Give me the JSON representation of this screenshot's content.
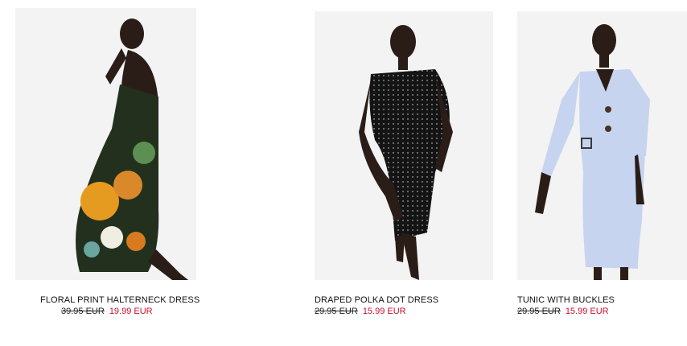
{
  "products": [
    {
      "name": "FLORAL PRINT HALTERNECK DRESS",
      "old_price": "39.95 EUR",
      "sale_price": "19.99 EUR",
      "image": "model-floral-halterneck-dress-photo"
    },
    {
      "name": "DRAPED POLKA DOT DRESS",
      "old_price": "29.95 EUR",
      "sale_price": "15.99 EUR",
      "image": "model-polka-dot-dress-photo"
    },
    {
      "name": "TUNIC WITH BUCKLES",
      "old_price": "29.95 EUR",
      "sale_price": "15.99 EUR",
      "image": "model-blue-tunic-photo"
    }
  ],
  "colors": {
    "background": "#ffffff",
    "image_background": "#f2f2f2",
    "sale_price": "#c8102e",
    "text": "#111111"
  }
}
